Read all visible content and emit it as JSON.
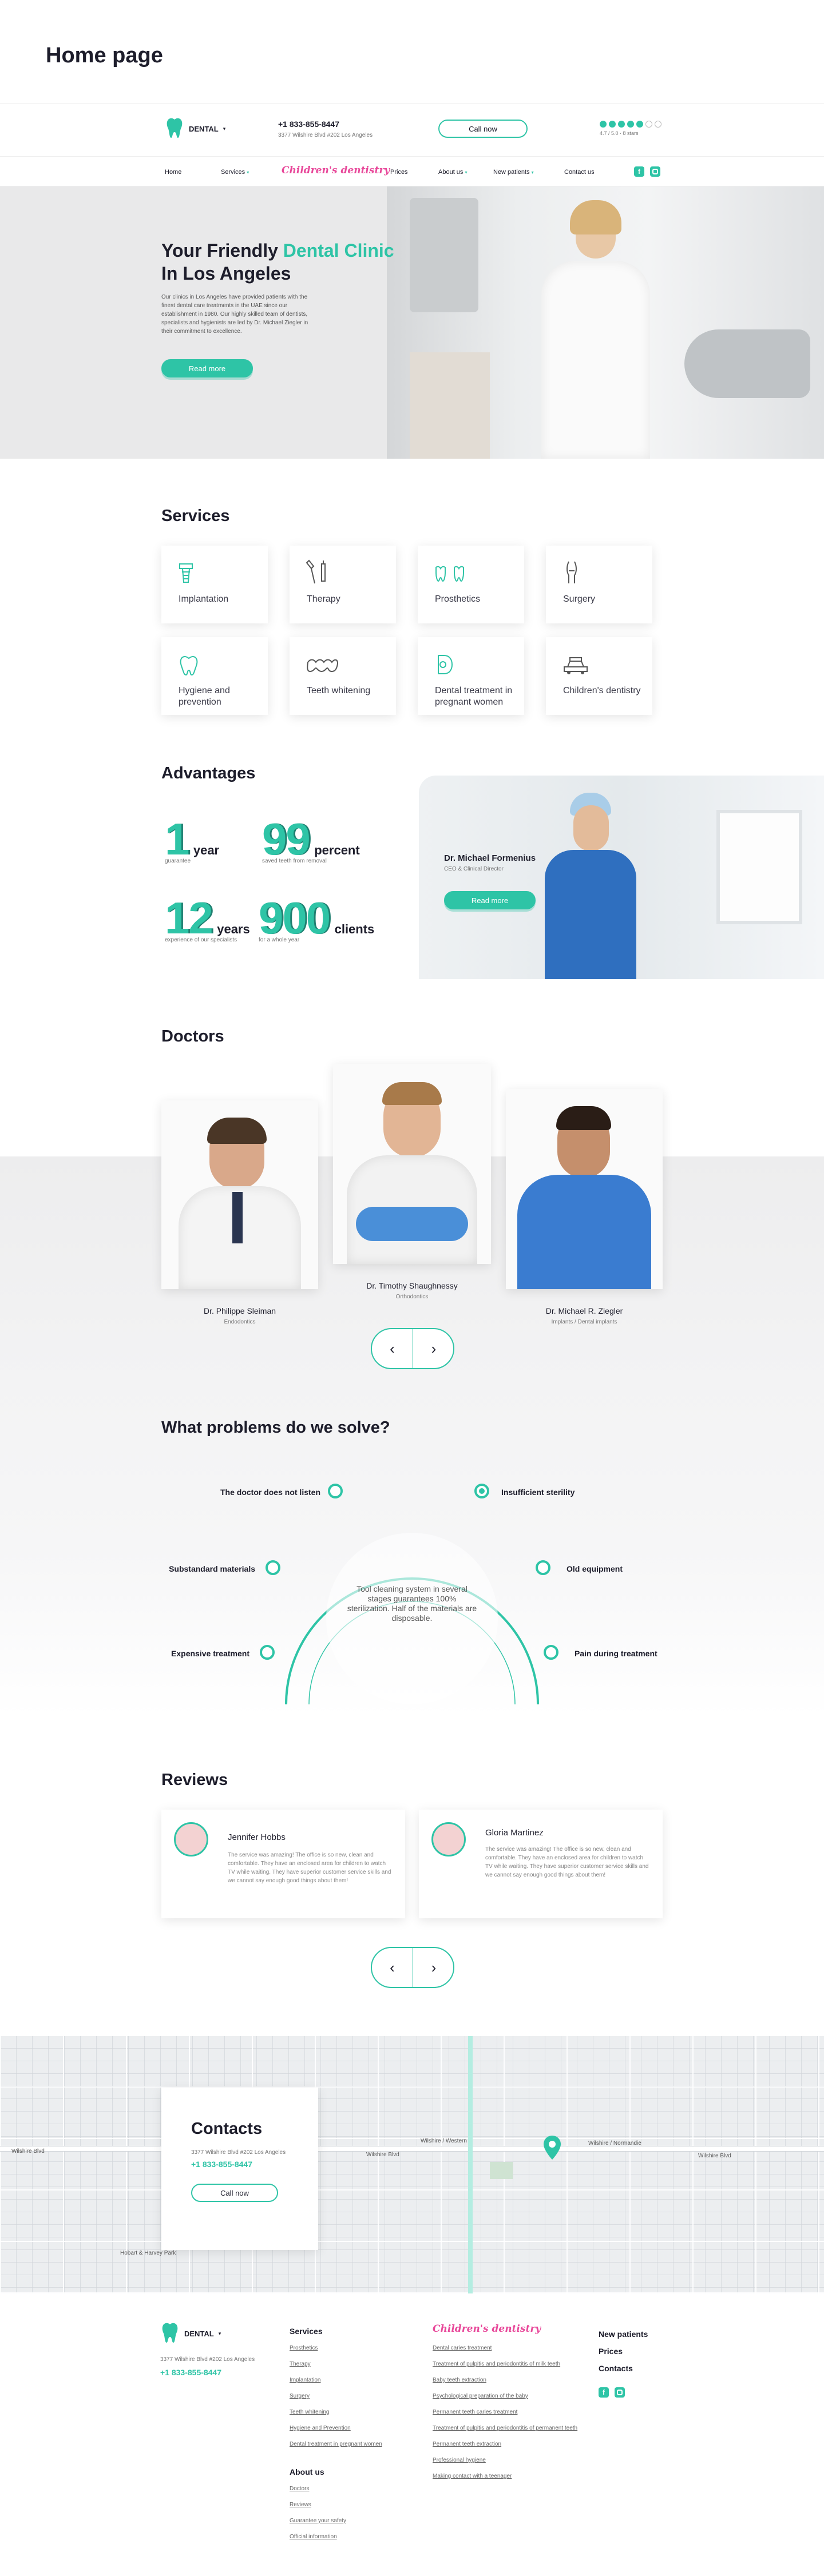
{
  "page_title": "Home page",
  "header": {
    "logo_text": "DENTAL",
    "phone": "+1 833-855-8447",
    "address": "3377 Wilshire Blvd #202 Los Angeles",
    "call_button": "Call now",
    "rating_text": "4.7 / 5.0 · 8 stars",
    "rating_value": 4.7
  },
  "nav": {
    "items": [
      "Home",
      "Services",
      "Prices",
      "About us",
      "New patients",
      "Contact us"
    ],
    "children_logo": "Children's dentistry"
  },
  "hero": {
    "title_part1": "Your Friendly ",
    "title_accent": "Dental Clinic",
    "title_part2": "In Los Angeles",
    "text": "Our clinics in Los Angeles have provided patients with the finest dental care treatments in the UAE since our establishment in 1980. Our highly skilled team of dentists, specialists and hygienists are led by Dr. Michael Ziegler in their commitment to excellence.",
    "button": "Read more"
  },
  "services": {
    "title": "Services",
    "items": [
      {
        "label": "Implantation",
        "icon": "implant-icon"
      },
      {
        "label": "Therapy",
        "icon": "therapy-icon"
      },
      {
        "label": "Prosthetics",
        "icon": "prosthetics-icon"
      },
      {
        "label": "Surgery",
        "icon": "surgery-icon"
      },
      {
        "label": "Hygiene and prevention",
        "icon": "hygiene-icon"
      },
      {
        "label": "Teeth whitening",
        "icon": "whitening-icon"
      },
      {
        "label": "Dental treatment in pregnant women",
        "icon": "pregnant-icon"
      },
      {
        "label": "Children's dentistry",
        "icon": "children-icon"
      }
    ]
  },
  "advantages": {
    "title": "Advantages",
    "stats": [
      {
        "number": "1",
        "unit": "year",
        "caption": "guarantee"
      },
      {
        "number": "99",
        "unit": "percent",
        "caption": "saved teeth from removal"
      },
      {
        "number": "12",
        "unit": "years",
        "caption": "experience of our specialists"
      },
      {
        "number": "900",
        "unit": "clients",
        "caption": "for a whole year"
      }
    ],
    "doctor_name": "Dr. Michael Formenius",
    "doctor_role": "CEO & Clinical Director",
    "button": "Read more"
  },
  "doctors": {
    "title": "Doctors",
    "items": [
      {
        "name": "Dr. Philippe Sleiman",
        "role": "Endodontics"
      },
      {
        "name": "Dr. Timothy Shaughnessy",
        "role": "Orthodontics"
      },
      {
        "name": "Dr. Michael R. Ziegler",
        "role": "Implants / Dental implants"
      }
    ]
  },
  "problems": {
    "title": "What problems do we solve?",
    "left": [
      "The doctor does not listen",
      "Substandard materials",
      "Expensive treatment"
    ],
    "right": [
      "Insufficient sterility",
      "Old equipment",
      "Pain during treatment"
    ],
    "center_text": "Tool cleaning system in several stages guarantees 100% sterilization. Half of the materials are disposable."
  },
  "reviews": {
    "title": "Reviews",
    "items": [
      {
        "name": "Jennifer Hobbs",
        "text": "The service was amazing! The office is so new, clean and comfortable. They have an enclosed area for children to watch TV while waiting. They have superior customer service skills and we cannot say enough good things about them!"
      },
      {
        "name": "Gloria Martinez",
        "text": "The service was amazing! The office is so new, clean and comfortable. They have an enclosed area for children to watch TV while waiting. They have superior customer service skills and we cannot say enough good things about them!"
      }
    ]
  },
  "contacts": {
    "title": "Contacts",
    "address": "3377 Wilshire Blvd #202 Los Angeles",
    "phone": "+1 833-855-8447",
    "button": "Call now",
    "map_labels": [
      "Wilshire / Western",
      "Wilshire Blvd",
      "Wilshire Blvd",
      "Wilshire / Normandie",
      "Hobart & Harvey Park",
      "Wilshire Blvd"
    ]
  },
  "footer": {
    "logo_text": "DENTAL",
    "address": "3377 Wilshire Blvd #202 Los Angeles",
    "phone": "+1 833-855-8447",
    "services_title": "Services",
    "services_links": [
      "Prosthetics",
      "Therapy",
      "Implantation",
      "Surgery",
      "Teeth whitening",
      "Hygiene and Prevention",
      "Dental treatment in pregnant women"
    ],
    "about_title": "About us",
    "about_links": [
      "Doctors",
      "Reviews",
      "Guarantee your safety",
      "Official information"
    ],
    "children_title": "Children's dentistry",
    "children_links": [
      "Dental caries treatment",
      "Treatment of pulpitis and periodontitis of milk teeth",
      "Baby teeth extraction",
      "Psychological preparation of the baby",
      "Permanent teeth caries treatment",
      "Treatment of pulpitis and periodontitis of permanent teeth",
      "Permanent teeth extraction",
      "Professional hygiene",
      "Making contact with a teenager"
    ],
    "right_links": [
      "New patients",
      "Prices",
      "Contacts"
    ]
  },
  "colors": {
    "accent": "#2ec4a6",
    "pink": "#e8489a",
    "dark": "#1d1d2b"
  }
}
